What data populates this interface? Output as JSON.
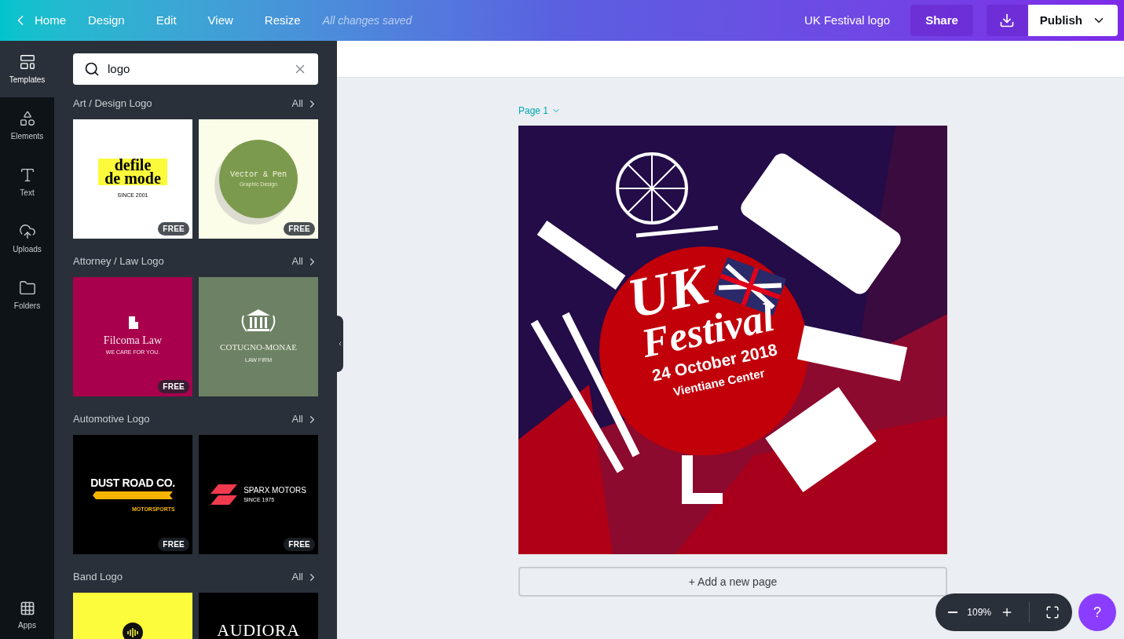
{
  "topbar": {
    "back": "Home",
    "menu": [
      "Design",
      "Edit",
      "View",
      "Resize"
    ],
    "status": "All changes saved",
    "doc_title": "UK Festival logo",
    "share": "Share",
    "publish": "Publish"
  },
  "rail": [
    {
      "label": "Templates",
      "selected": true
    },
    {
      "label": "Elements",
      "selected": false
    },
    {
      "label": "Text",
      "selected": false
    },
    {
      "label": "Uploads",
      "selected": false
    },
    {
      "label": "Folders",
      "selected": false
    }
  ],
  "rail_bottom": {
    "label": "Apps"
  },
  "search": {
    "value": "logo"
  },
  "sections": [
    {
      "title": "Art / Design Logo",
      "all": "All",
      "templates": [
        {
          "lines": [
            "defile",
            "de mode",
            "SINCE 2001"
          ],
          "badge": "FREE"
        },
        {
          "lines": [
            "Vector & Pen",
            "Graphic Design"
          ],
          "badge": "FREE"
        }
      ]
    },
    {
      "title": "Attorney / Law Logo",
      "all": "All",
      "templates": [
        {
          "lines": [
            "Filcoma Law",
            "WE CARE FOR YOU."
          ],
          "badge": "FREE"
        },
        {
          "lines": [
            "COTUGNO-MONAE",
            "LAW FIRM"
          ]
        }
      ]
    },
    {
      "title": "Automotive Logo",
      "all": "All",
      "templates": [
        {
          "lines": [
            "DUST ROAD CO.",
            "MOTORSPORTS"
          ],
          "badge": "FREE"
        },
        {
          "lines": [
            "SPARX MOTORS",
            "SINCE 1975"
          ],
          "badge": "FREE"
        }
      ]
    },
    {
      "title": "Band Logo",
      "all": "All",
      "templates": [
        {
          "kind": "picture"
        },
        {
          "lines": [
            "AUDIORA"
          ]
        }
      ]
    }
  ],
  "page_label": "Page 1",
  "design": {
    "title": "UK",
    "subtitle": "Festival",
    "date": "24 October 2018",
    "venue": "Vientiane Center"
  },
  "add_page": "+ Add a new page",
  "zoom": {
    "value": "109%"
  },
  "help": "?"
}
